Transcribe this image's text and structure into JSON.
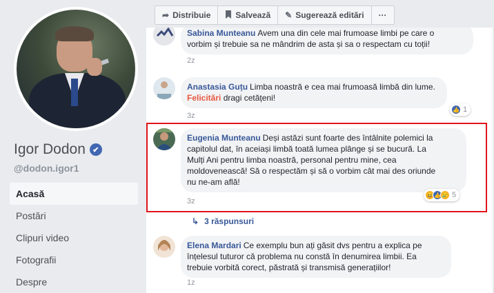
{
  "profile": {
    "name": "Igor Dodon",
    "handle": "@dodon.igor1",
    "verified_icon": "✔"
  },
  "nav": [
    {
      "label": "Acasă",
      "active": true
    },
    {
      "label": "Postări"
    },
    {
      "label": "Clipuri video"
    },
    {
      "label": "Fotografii"
    },
    {
      "label": "Despre"
    }
  ],
  "toolbar": {
    "share_label": "Distribuie",
    "save_label": "Salvează",
    "suggest_label": "Sugerează editări",
    "more_label": "···"
  },
  "comments": [
    {
      "author": "Sabina Munteanu",
      "text_1": "Avem una din cele mai frumoase limbi pe care o",
      "text_2": "vorbim și trebuie sa ne mândrim de asta și sa o respectam cu toții!",
      "time": "2z"
    },
    {
      "author": "Anastasia Guțu",
      "text_1": "Limba noastră e cea mai frumoasă limbă din lume.",
      "link": "Felicitări",
      "text_2": "dragi cetățeni!",
      "time": "3z",
      "reaction_count": "1"
    },
    {
      "author": "Eugenia Munteanu",
      "text_1": "Deși astăzi sunt foarte des întâlnite polemici la",
      "text_2": "capitolul dat, în aceiași limbă toată lumea plânge și se bucură. La",
      "text_3": "Mulți Ani pentru limba noastră, personal pentru mine, cea",
      "text_4": "moldovenească! Să o respectăm și să o vorbim cât mai des oriunde",
      "text_5": "nu ne-am află!",
      "time": "3z",
      "reaction_count": "5",
      "replies": "3 răspunsuri"
    },
    {
      "author": "Elena Mardari",
      "text_1": "Ce exemplu bun ați găsit dvs pentru a explica pe",
      "text_2": "înțelesul tuturor că problema nu constă în denumirea limbii. Ea",
      "text_3": "trebuie vorbită corect, păstrată și transmisă generațiilor!",
      "time": "1z"
    }
  ],
  "colors": {
    "link": "#385898",
    "highlight": "#e0121b",
    "accent": "#4267b2"
  }
}
